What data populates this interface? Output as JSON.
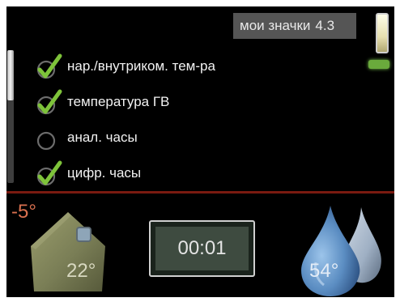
{
  "header": {
    "title": "мои значки",
    "code": "4.3"
  },
  "options": [
    {
      "label": "нар./внутриком. тем-ра",
      "checked": true
    },
    {
      "label": "температура ГВ",
      "checked": true
    },
    {
      "label": "анал. часы",
      "checked": false
    },
    {
      "label": "цифр. часы",
      "checked": true
    }
  ],
  "status": {
    "outdoor_temp": "-5°",
    "indoor_temp": "22°",
    "clock": "00:01",
    "hot_water_temp": "54°"
  },
  "colors": {
    "checkmark": "#7ec33a",
    "outdoor_temp": "#d9704f",
    "house": "#7a7e56",
    "water_drop": "#5b8dc2",
    "divider": "#7a1a10"
  },
  "icons": {
    "check": "checkbox-checked-icon",
    "uncheck": "checkbox-empty-icon",
    "house": "house-icon",
    "drops": "water-drop-icon"
  }
}
